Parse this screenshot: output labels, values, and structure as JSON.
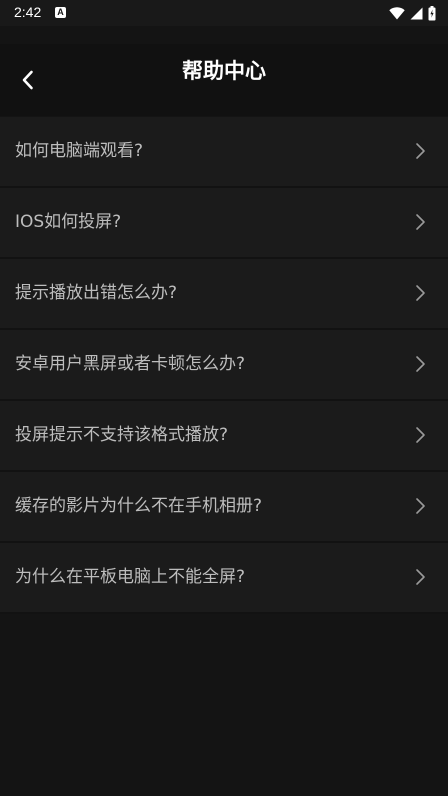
{
  "status_bar": {
    "time": "2:42",
    "notification_letter": "A",
    "icons": [
      "wifi-icon",
      "signal-icon",
      "battery-icon"
    ]
  },
  "header": {
    "title": "帮助中心",
    "back_icon": "chevron-left-icon"
  },
  "faq": {
    "items": [
      {
        "label": "如何电脑端观看?"
      },
      {
        "label": "IOS如何投屏?"
      },
      {
        "label": "提示播放出错怎么办?"
      },
      {
        "label": "安卓用户黑屏或者卡顿怎么办?"
      },
      {
        "label": "投屏提示不支持该格式播放?"
      },
      {
        "label": "缓存的影片为什么不在手机相册?"
      },
      {
        "label": "为什么在平板电脑上不能全屏?"
      }
    ],
    "row_icon": "chevron-right-icon"
  },
  "colors": {
    "background": "#141414",
    "header": "#111111",
    "row": "#1b1b1b",
    "row_text": "#bdbdbd",
    "title_text": "#ffffff"
  }
}
